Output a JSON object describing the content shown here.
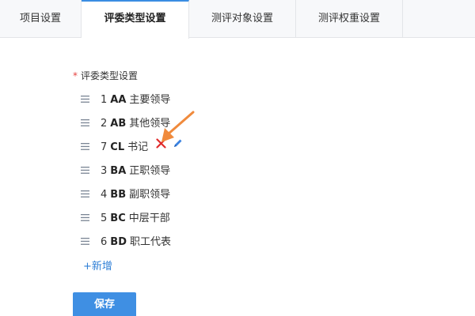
{
  "tabs": [
    {
      "label": "项目设置",
      "active": false
    },
    {
      "label": "评委类型设置",
      "active": true
    },
    {
      "label": "测评对象设置",
      "active": false
    },
    {
      "label": "测评权重设置",
      "active": false
    }
  ],
  "section": {
    "required_mark": "*",
    "label": "评委类型设置"
  },
  "items": [
    {
      "index": "1",
      "code": "AA",
      "name": "主要领导"
    },
    {
      "index": "2",
      "code": "AB",
      "name": "其他领导"
    },
    {
      "index": "7",
      "code": "CL",
      "name": "书记",
      "hovered": true
    },
    {
      "index": "3",
      "code": "BA",
      "name": "正职领导"
    },
    {
      "index": "4",
      "code": "BB",
      "name": "副职领导"
    },
    {
      "index": "5",
      "code": "BC",
      "name": "中层干部"
    },
    {
      "index": "6",
      "code": "BD",
      "name": "职工代表"
    }
  ],
  "add_label": "+新增",
  "save_label": "保存",
  "icons": {
    "drag": "drag-handle-icon",
    "delete": "close-icon",
    "edit": "pencil-icon",
    "annotation": "arrow-icon"
  },
  "colors": {
    "accent": "#3f8fe3",
    "link": "#2f7fd6",
    "delete": "#e02b2b",
    "edit": "#3b82e0",
    "annotation": "#f08a3c",
    "required": "#e64340"
  }
}
